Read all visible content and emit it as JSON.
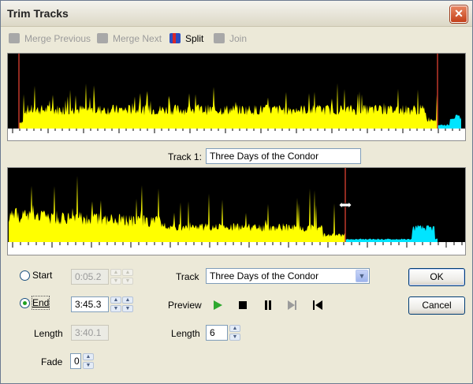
{
  "window": {
    "title": "Trim Tracks",
    "close_glyph": "✕"
  },
  "toolbar": {
    "merge_previous": "Merge Previous",
    "merge_next": "Merge Next",
    "split": "Split",
    "join": "Join"
  },
  "track": {
    "label": "Track 1:",
    "name": "Three Days of the Condor"
  },
  "start": {
    "label": "Start",
    "value": "0:05.2"
  },
  "end": {
    "label": "End",
    "value": "3:45.3"
  },
  "length_left": {
    "label": "Length",
    "value": "3:40.1"
  },
  "fade": {
    "label": "Fade",
    "value": "0"
  },
  "track_select": {
    "label": "Track",
    "value": "Three Days of the Condor"
  },
  "preview": {
    "label": "Preview"
  },
  "length_right": {
    "label": "Length",
    "value": "6"
  },
  "buttons": {
    "ok": "OK",
    "cancel": "Cancel"
  },
  "colors": {
    "waveform": "#ffff00",
    "trimmed": "#00e5ff",
    "marker": "#c0392b",
    "play": "#2ea82e"
  }
}
